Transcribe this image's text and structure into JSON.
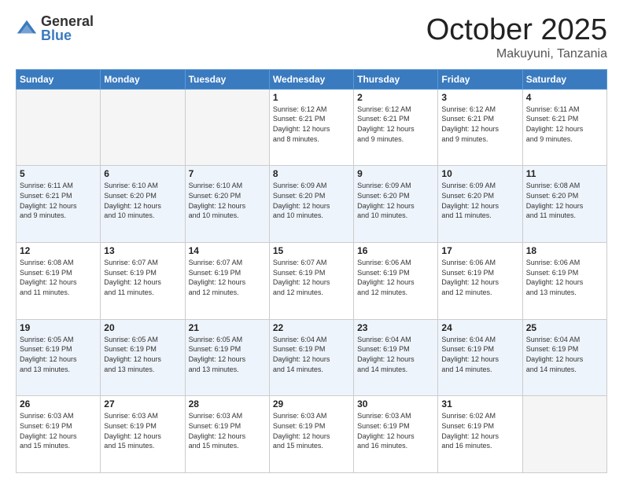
{
  "logo": {
    "general": "General",
    "blue": "Blue"
  },
  "header": {
    "month": "October 2025",
    "location": "Makuyuni, Tanzania"
  },
  "weekdays": [
    "Sunday",
    "Monday",
    "Tuesday",
    "Wednesday",
    "Thursday",
    "Friday",
    "Saturday"
  ],
  "weeks": [
    [
      {
        "day": "",
        "info": ""
      },
      {
        "day": "",
        "info": ""
      },
      {
        "day": "",
        "info": ""
      },
      {
        "day": "1",
        "info": "Sunrise: 6:12 AM\nSunset: 6:21 PM\nDaylight: 12 hours\nand 8 minutes."
      },
      {
        "day": "2",
        "info": "Sunrise: 6:12 AM\nSunset: 6:21 PM\nDaylight: 12 hours\nand 9 minutes."
      },
      {
        "day": "3",
        "info": "Sunrise: 6:12 AM\nSunset: 6:21 PM\nDaylight: 12 hours\nand 9 minutes."
      },
      {
        "day": "4",
        "info": "Sunrise: 6:11 AM\nSunset: 6:21 PM\nDaylight: 12 hours\nand 9 minutes."
      }
    ],
    [
      {
        "day": "5",
        "info": "Sunrise: 6:11 AM\nSunset: 6:21 PM\nDaylight: 12 hours\nand 9 minutes."
      },
      {
        "day": "6",
        "info": "Sunrise: 6:10 AM\nSunset: 6:20 PM\nDaylight: 12 hours\nand 10 minutes."
      },
      {
        "day": "7",
        "info": "Sunrise: 6:10 AM\nSunset: 6:20 PM\nDaylight: 12 hours\nand 10 minutes."
      },
      {
        "day": "8",
        "info": "Sunrise: 6:09 AM\nSunset: 6:20 PM\nDaylight: 12 hours\nand 10 minutes."
      },
      {
        "day": "9",
        "info": "Sunrise: 6:09 AM\nSunset: 6:20 PM\nDaylight: 12 hours\nand 10 minutes."
      },
      {
        "day": "10",
        "info": "Sunrise: 6:09 AM\nSunset: 6:20 PM\nDaylight: 12 hours\nand 11 minutes."
      },
      {
        "day": "11",
        "info": "Sunrise: 6:08 AM\nSunset: 6:20 PM\nDaylight: 12 hours\nand 11 minutes."
      }
    ],
    [
      {
        "day": "12",
        "info": "Sunrise: 6:08 AM\nSunset: 6:19 PM\nDaylight: 12 hours\nand 11 minutes."
      },
      {
        "day": "13",
        "info": "Sunrise: 6:07 AM\nSunset: 6:19 PM\nDaylight: 12 hours\nand 11 minutes."
      },
      {
        "day": "14",
        "info": "Sunrise: 6:07 AM\nSunset: 6:19 PM\nDaylight: 12 hours\nand 12 minutes."
      },
      {
        "day": "15",
        "info": "Sunrise: 6:07 AM\nSunset: 6:19 PM\nDaylight: 12 hours\nand 12 minutes."
      },
      {
        "day": "16",
        "info": "Sunrise: 6:06 AM\nSunset: 6:19 PM\nDaylight: 12 hours\nand 12 minutes."
      },
      {
        "day": "17",
        "info": "Sunrise: 6:06 AM\nSunset: 6:19 PM\nDaylight: 12 hours\nand 12 minutes."
      },
      {
        "day": "18",
        "info": "Sunrise: 6:06 AM\nSunset: 6:19 PM\nDaylight: 12 hours\nand 13 minutes."
      }
    ],
    [
      {
        "day": "19",
        "info": "Sunrise: 6:05 AM\nSunset: 6:19 PM\nDaylight: 12 hours\nand 13 minutes."
      },
      {
        "day": "20",
        "info": "Sunrise: 6:05 AM\nSunset: 6:19 PM\nDaylight: 12 hours\nand 13 minutes."
      },
      {
        "day": "21",
        "info": "Sunrise: 6:05 AM\nSunset: 6:19 PM\nDaylight: 12 hours\nand 13 minutes."
      },
      {
        "day": "22",
        "info": "Sunrise: 6:04 AM\nSunset: 6:19 PM\nDaylight: 12 hours\nand 14 minutes."
      },
      {
        "day": "23",
        "info": "Sunrise: 6:04 AM\nSunset: 6:19 PM\nDaylight: 12 hours\nand 14 minutes."
      },
      {
        "day": "24",
        "info": "Sunrise: 6:04 AM\nSunset: 6:19 PM\nDaylight: 12 hours\nand 14 minutes."
      },
      {
        "day": "25",
        "info": "Sunrise: 6:04 AM\nSunset: 6:19 PM\nDaylight: 12 hours\nand 14 minutes."
      }
    ],
    [
      {
        "day": "26",
        "info": "Sunrise: 6:03 AM\nSunset: 6:19 PM\nDaylight: 12 hours\nand 15 minutes."
      },
      {
        "day": "27",
        "info": "Sunrise: 6:03 AM\nSunset: 6:19 PM\nDaylight: 12 hours\nand 15 minutes."
      },
      {
        "day": "28",
        "info": "Sunrise: 6:03 AM\nSunset: 6:19 PM\nDaylight: 12 hours\nand 15 minutes."
      },
      {
        "day": "29",
        "info": "Sunrise: 6:03 AM\nSunset: 6:19 PM\nDaylight: 12 hours\nand 15 minutes."
      },
      {
        "day": "30",
        "info": "Sunrise: 6:03 AM\nSunset: 6:19 PM\nDaylight: 12 hours\nand 16 minutes."
      },
      {
        "day": "31",
        "info": "Sunrise: 6:02 AM\nSunset: 6:19 PM\nDaylight: 12 hours\nand 16 minutes."
      },
      {
        "day": "",
        "info": ""
      }
    ]
  ]
}
